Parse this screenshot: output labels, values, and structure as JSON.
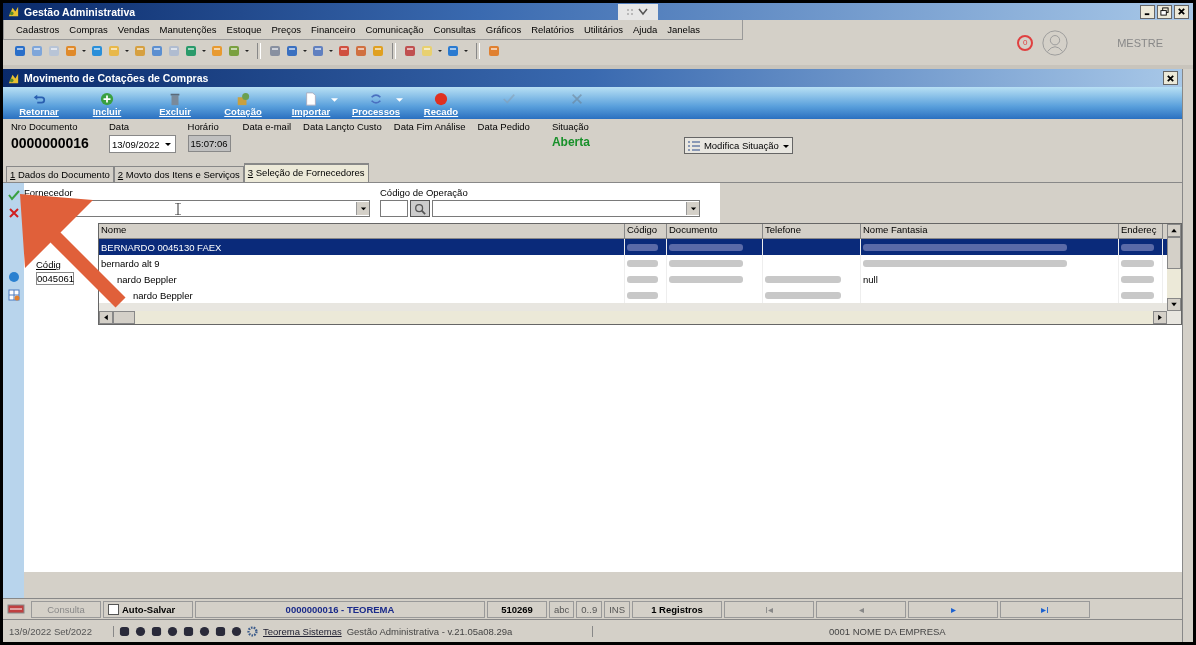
{
  "app_title": "Gestão Administrativa",
  "menu": [
    "Cadastros",
    "Compras",
    "Vendas",
    "Manutenções",
    "Estoque",
    "Preços",
    "Financeiro",
    "Comunicação",
    "Consultas",
    "Gráficos",
    "Relatórios",
    "Utilitários",
    "Ajuda",
    "Janelas"
  ],
  "user": {
    "notifications": "0",
    "name": "MESTRE"
  },
  "window_title": "Movimento de Cotações de Compras",
  "actions": [
    {
      "kind": "back",
      "label": "Retornar",
      "disabled": false,
      "dropdown": false
    },
    {
      "kind": "add",
      "label": "Incluir",
      "disabled": false,
      "dropdown": false
    },
    {
      "kind": "delete",
      "label": "Excluir",
      "disabled": false,
      "dropdown": false
    },
    {
      "kind": "quote",
      "label": "Cotação",
      "disabled": false,
      "dropdown": false
    },
    {
      "kind": "import",
      "label": "Importar",
      "disabled": false,
      "dropdown": true
    },
    {
      "kind": "process",
      "label": "Processos",
      "disabled": false,
      "dropdown": true
    },
    {
      "kind": "note",
      "label": "Recado",
      "disabled": false,
      "dropdown": false
    },
    {
      "kind": "confirm",
      "disabled": true,
      "dropdown": false
    },
    {
      "kind": "cancel",
      "disabled": true,
      "dropdown": false
    }
  ],
  "header": [
    {
      "kind": "number",
      "label": "Nro Documento",
      "value": "0000000016"
    },
    {
      "kind": "date",
      "label": "Data",
      "value": "13/09/2022"
    },
    {
      "kind": "time",
      "label": "Horário",
      "value": "15:07:06"
    },
    {
      "kind": "empty",
      "label": "Data e-mail"
    },
    {
      "kind": "empty",
      "label": "Data Lançto Custo"
    },
    {
      "kind": "empty",
      "label": "Data Fim Análise"
    },
    {
      "kind": "empty",
      "label": "Data Pedido"
    },
    {
      "kind": "status",
      "label": "Situação",
      "value": "Aberta"
    }
  ],
  "status_button": "Modifica Situação",
  "tabs": [
    {
      "key": "1",
      "label": " Dados do Documento",
      "selected": false
    },
    {
      "key": "2",
      "label": " Movto dos Itens e Serviços",
      "selected": false
    },
    {
      "key": "3",
      "label": " Seleção de Fornecedores",
      "selected": true
    }
  ],
  "form": {
    "supplier_label": "Fornecedor",
    "operation_label": "Código de Operação",
    "side_label": "Códig",
    "side_value": "0045061"
  },
  "grid": {
    "columns": [
      "Nome",
      "Código",
      "Documento",
      "Telefone",
      "Nome Fantasia",
      "Endereç"
    ],
    "rows": [
      {
        "selected": true,
        "cells": [
          {
            "text": "BERNARDO 0045130 FAEX"
          },
          {
            "redacted": true
          },
          {
            "redacted": true
          },
          null,
          {
            "redacted": true
          },
          {
            "redacted": true
          }
        ]
      },
      {
        "selected": false,
        "cells": [
          {
            "text": "bernardo alt 9"
          },
          {
            "redacted": true
          },
          {
            "redacted": true
          },
          null,
          {
            "redacted": true
          },
          {
            "redacted": true
          }
        ]
      },
      {
        "selected": false,
        "cells": [
          {
            "text": "nardo Beppler"
          },
          {
            "redacted": true
          },
          {
            "redacted": true
          },
          {
            "redacted": true
          },
          {
            "text": "null"
          },
          {
            "redacted": true
          }
        ]
      },
      {
        "selected": false,
        "cells": [
          {
            "text": "nardo Beppler"
          },
          {
            "redacted": true
          },
          null,
          {
            "redacted": true
          },
          null,
          {
            "redacted": true
          }
        ]
      }
    ]
  },
  "status_bar": {
    "query_button": "Consulta",
    "auto_save": {
      "label": "Auto-Salvar",
      "checked": false
    },
    "record": "0000000016 - TEOREMA",
    "code": "510269",
    "modes": [
      "abc",
      "0..9",
      "INS"
    ],
    "count": "1 Registros",
    "nav": [
      "I◂",
      "◂",
      "▸",
      "▸I"
    ]
  },
  "footer": {
    "date": "13/9/2022 Set/2022",
    "link": "Teorema Sistemas",
    "version": "Gestão Administrativa - v.21.05a08.29a",
    "company": "0001 NOME DA EMPRESA"
  }
}
